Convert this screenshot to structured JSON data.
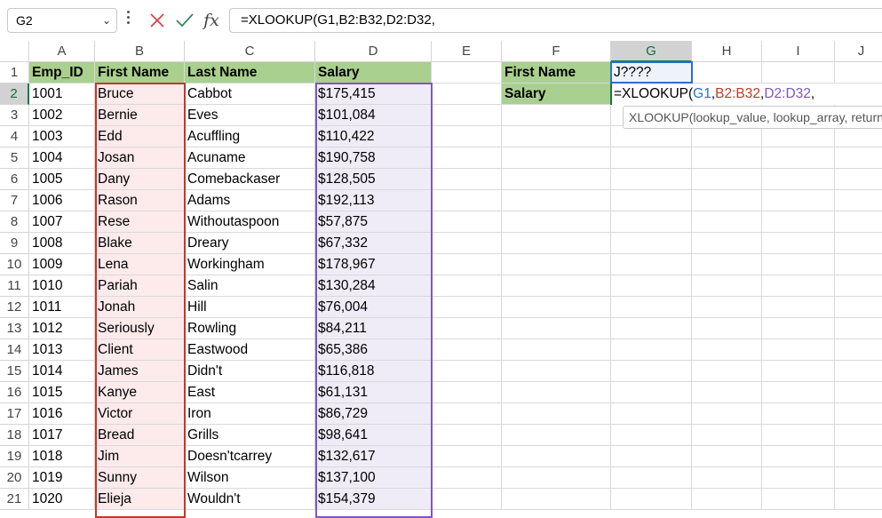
{
  "formula_bar": {
    "name_box": "G2",
    "cancel_icon": "close-icon",
    "enter_icon": "check-icon",
    "fx_label": "fx",
    "formula": "=XLOOKUP(G1,B2:B32,D2:D32,"
  },
  "columns": [
    "A",
    "B",
    "C",
    "D",
    "E",
    "F",
    "G",
    "H",
    "I",
    "J"
  ],
  "rows": [
    "1",
    "2",
    "3",
    "4",
    "5",
    "6",
    "7",
    "8",
    "9",
    "10",
    "11",
    "12",
    "13",
    "14",
    "15",
    "16",
    "17",
    "18",
    "19",
    "20",
    "21"
  ],
  "headers": {
    "a": "Emp_ID",
    "b": "First Name",
    "c": "Last Name",
    "d": "Salary"
  },
  "table": [
    [
      "1001",
      "Bruce",
      "Cabbot",
      "$175,415"
    ],
    [
      "1002",
      "Bernie",
      "Eves",
      "$101,084"
    ],
    [
      "1003",
      "Edd",
      "Acuffling",
      "$110,422"
    ],
    [
      "1004",
      "Josan",
      "Acuname",
      "$190,758"
    ],
    [
      "1005",
      "Dany",
      "Comebackaser",
      "$128,505"
    ],
    [
      "1006",
      "Rason",
      "Adams",
      "$192,113"
    ],
    [
      "1007",
      "Rese",
      "Withoutaspoon",
      "$57,875"
    ],
    [
      "1008",
      "Blake",
      "Dreary",
      "$67,332"
    ],
    [
      "1009",
      "Lena",
      "Workingham",
      "$178,967"
    ],
    [
      "1010",
      "Pariah",
      "Salin",
      "$130,284"
    ],
    [
      "1011",
      "Jonah",
      "Hill",
      "$76,004"
    ],
    [
      "1012",
      "Seriously",
      "Rowling",
      "$84,211"
    ],
    [
      "1013",
      "Client",
      "Eastwood",
      "$65,386"
    ],
    [
      "1014",
      "James",
      "Didn't",
      "$116,818"
    ],
    [
      "1015",
      "Kanye",
      "East",
      "$61,131"
    ],
    [
      "1016",
      "Victor",
      "Iron",
      "$86,729"
    ],
    [
      "1017",
      "Bread",
      "Grills",
      "$98,641"
    ],
    [
      "1018",
      "Jim",
      "Doesn'tcarrey",
      "$132,617"
    ],
    [
      "1019",
      "Sunny",
      "Wilson",
      "$137,100"
    ],
    [
      "1020",
      "Elieja",
      "Wouldn't",
      "$154,379"
    ]
  ],
  "lookup": {
    "f1": "First Name",
    "g1": "J????",
    "f2": "Salary",
    "g2_parts": [
      "=XLOOKUP(",
      "G1",
      ",",
      "B2:B32",
      ",",
      "D2:D32",
      ","
    ]
  },
  "tooltip": "XLOOKUP(lookup_value, lookup_array, return_array, [if_not_found], [match_mode], [search_mode])",
  "colors": {
    "header_green": "#a9d08e",
    "ref_blue": "#2f6fc7",
    "ref_red": "#c0392b",
    "ref_purple": "#7e57c2",
    "selection_green": "#107c41"
  }
}
